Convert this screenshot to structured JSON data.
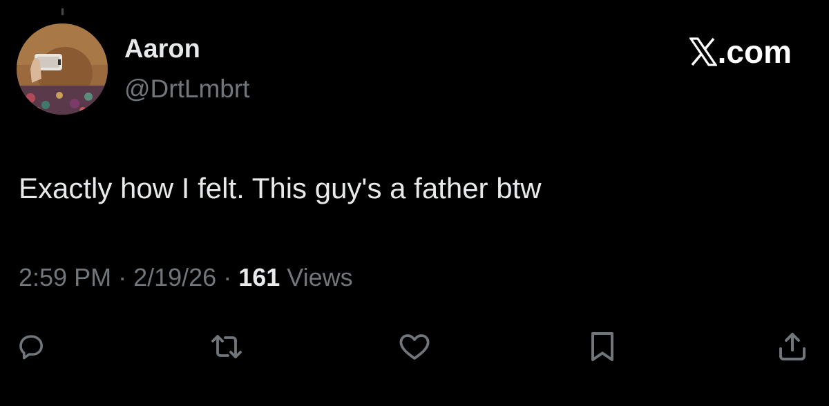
{
  "author": {
    "display_name": "Aaron",
    "handle": "@DrtLmbrt",
    "avatar_icon": "profile-photo"
  },
  "brand": {
    "label": ".com",
    "icon": "x-logo-icon"
  },
  "tweet": {
    "text": "Exactly how I felt. This guy's a father btw"
  },
  "meta": {
    "time": "2:59 PM",
    "separator": "·",
    "date": "2/19/26",
    "views_count": "161",
    "views_label": "Views"
  },
  "actions": [
    {
      "name": "reply",
      "icon": "comment-icon"
    },
    {
      "name": "repost",
      "icon": "repost-icon"
    },
    {
      "name": "like",
      "icon": "heart-icon"
    },
    {
      "name": "bookmark",
      "icon": "bookmark-icon"
    },
    {
      "name": "share",
      "icon": "share-icon"
    }
  ],
  "colors": {
    "background": "#000000",
    "primary_text": "#e7e9ea",
    "secondary_text": "#71767b",
    "icon": "#71767b"
  }
}
